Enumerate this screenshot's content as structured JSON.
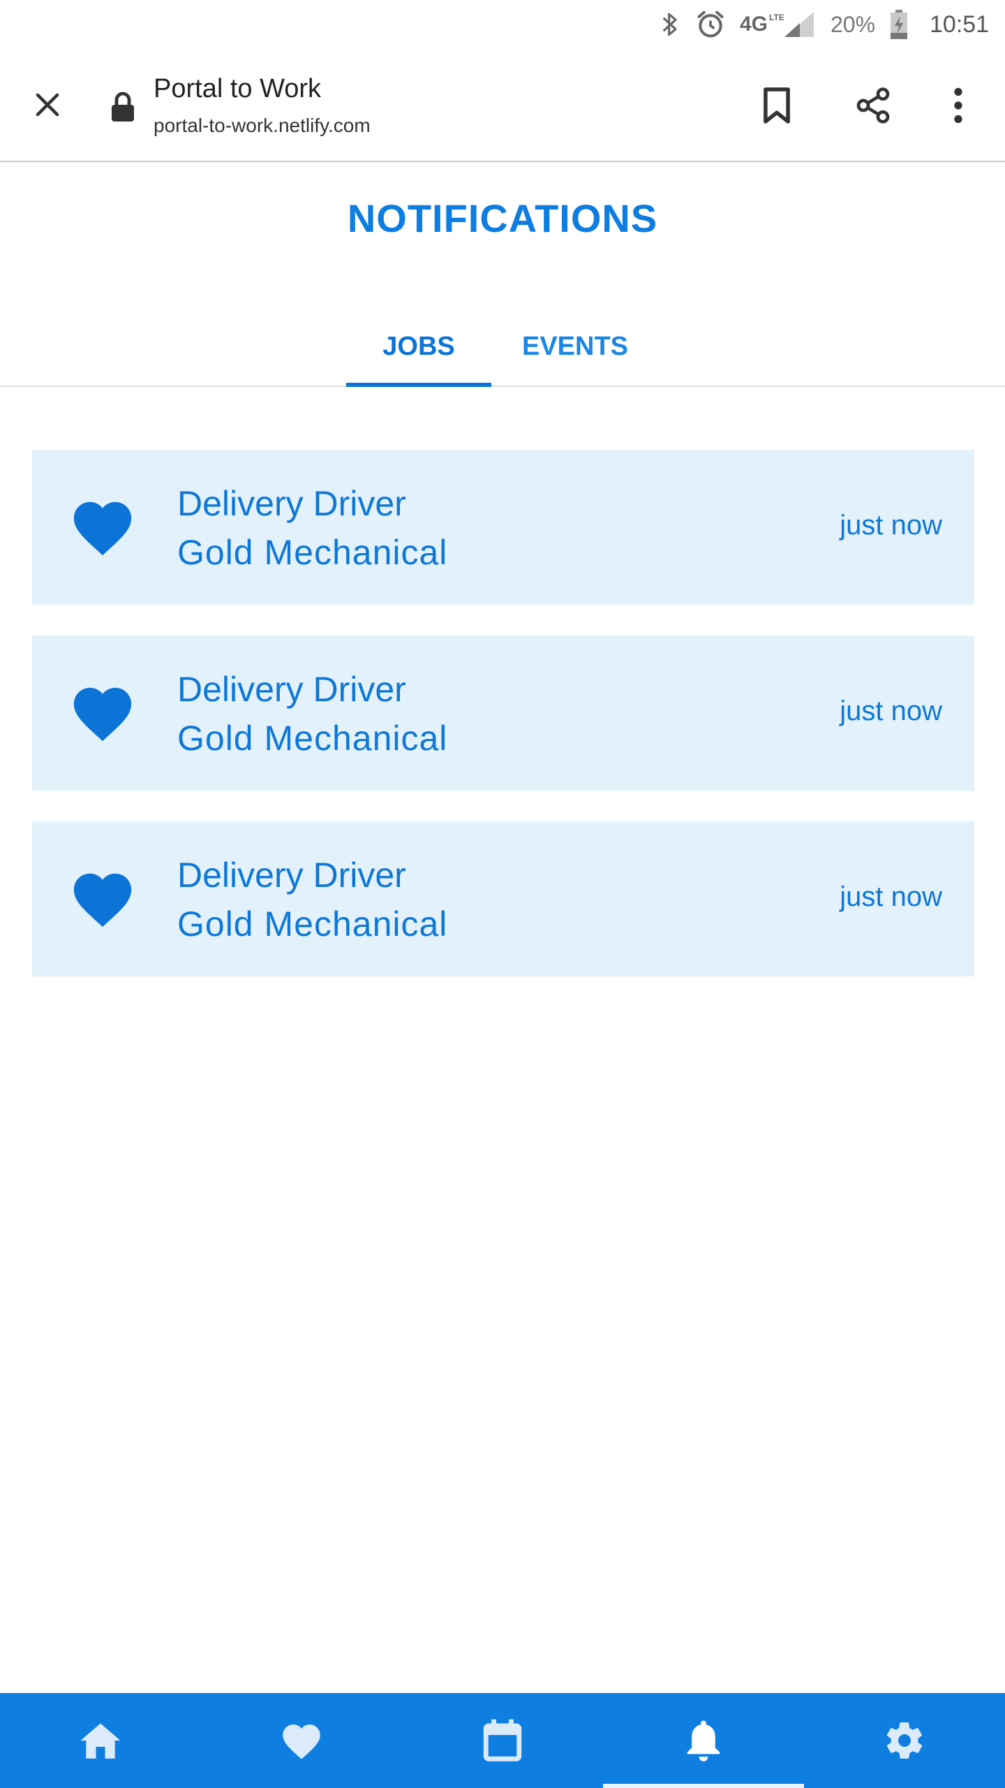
{
  "status_bar": {
    "network": "4G",
    "network_sub": "LTE",
    "battery_percent": "20%",
    "time": "10:51"
  },
  "browser": {
    "title": "Portal to Work",
    "url": "portal-to-work.netlify.com"
  },
  "page": {
    "title": "NOTIFICATIONS"
  },
  "tabs": [
    {
      "label": "JOBS",
      "active": true
    },
    {
      "label": "EVENTS",
      "active": false
    }
  ],
  "notifications": [
    {
      "title": "Delivery Driver",
      "company": "Gold Mechanical",
      "time": "just now",
      "icon": "heart-icon"
    },
    {
      "title": "Delivery Driver",
      "company": "Gold Mechanical",
      "time": "just now",
      "icon": "heart-icon"
    },
    {
      "title": "Delivery Driver",
      "company": "Gold Mechanical",
      "time": "just now",
      "icon": "heart-icon"
    }
  ],
  "bottom_nav": [
    {
      "icon": "home-icon"
    },
    {
      "icon": "heart-icon"
    },
    {
      "icon": "calendar-icon"
    },
    {
      "icon": "bell-icon",
      "active": true
    },
    {
      "icon": "gear-icon"
    }
  ],
  "colors": {
    "primary": "#0f7ee1",
    "card_background": "#e3f1fb",
    "text_primary": "#0d78d8"
  }
}
